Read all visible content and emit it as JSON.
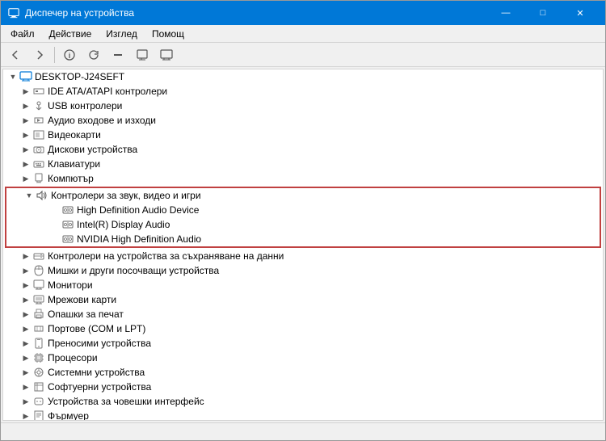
{
  "window": {
    "title": "Диспечер на устройства",
    "controls": {
      "minimize": "—",
      "maximize": "□",
      "close": "✕"
    }
  },
  "menu": {
    "items": [
      "Файл",
      "Действие",
      "Изглед",
      "Помощ"
    ]
  },
  "toolbar": {
    "buttons": [
      {
        "name": "back",
        "icon": "◀"
      },
      {
        "name": "forward",
        "icon": "▶"
      },
      {
        "name": "separator"
      },
      {
        "name": "properties",
        "icon": "ℹ"
      },
      {
        "name": "update",
        "icon": "↻"
      },
      {
        "name": "uninstall",
        "icon": "✖"
      },
      {
        "name": "scan",
        "icon": "🔍"
      },
      {
        "name": "monitor",
        "icon": "🖥"
      }
    ]
  },
  "tree": {
    "root": "DESKTOP-J24SEFT",
    "items": [
      {
        "id": "root",
        "label": "DESKTOP-J24SEFT",
        "level": 0,
        "expanded": true,
        "icon": "computer"
      },
      {
        "id": "ide",
        "label": "IDE ATA/ATAPI контролери",
        "level": 1,
        "expanded": false,
        "icon": "ide"
      },
      {
        "id": "usb",
        "label": "USB контролери",
        "level": 1,
        "expanded": false,
        "icon": "usb"
      },
      {
        "id": "audio_in",
        "label": "Аудио входове и изходи",
        "level": 1,
        "expanded": false,
        "icon": "audio"
      },
      {
        "id": "video",
        "label": "Видеокарти",
        "level": 1,
        "expanded": false,
        "icon": "video"
      },
      {
        "id": "disk",
        "label": "Дискови устройства",
        "level": 1,
        "expanded": false,
        "icon": "disk"
      },
      {
        "id": "keyboard",
        "label": "Клавиатури",
        "level": 1,
        "expanded": false,
        "icon": "keyboard"
      },
      {
        "id": "computer",
        "label": "Компютър",
        "level": 1,
        "expanded": false,
        "icon": "pc"
      },
      {
        "id": "sound_ctrl",
        "label": "Контролери за звук, видео и игри",
        "level": 1,
        "expanded": true,
        "icon": "sound",
        "highlighted": true
      },
      {
        "id": "hd_audio",
        "label": "High Definition Audio Device",
        "level": 2,
        "expanded": false,
        "icon": "device",
        "highlighted": true
      },
      {
        "id": "intel_audio",
        "label": "Intel(R) Display Audio",
        "level": 2,
        "expanded": false,
        "icon": "device",
        "highlighted": true
      },
      {
        "id": "nvidia_audio",
        "label": "NVIDIA High Definition Audio",
        "level": 2,
        "expanded": false,
        "icon": "device",
        "highlighted": true
      },
      {
        "id": "storage_ctrl",
        "label": "Контролери на устройства за съхраняване на данни",
        "level": 1,
        "expanded": false,
        "icon": "hdd"
      },
      {
        "id": "mouse",
        "label": "Мишки и други посочващи устройства",
        "level": 1,
        "expanded": false,
        "icon": "mouse"
      },
      {
        "id": "monitors",
        "label": "Монитори",
        "level": 1,
        "expanded": false,
        "icon": "monitor"
      },
      {
        "id": "network",
        "label": "Мрежови карти",
        "level": 1,
        "expanded": false,
        "icon": "network"
      },
      {
        "id": "print",
        "label": "Опашки за печат",
        "level": 1,
        "expanded": false,
        "icon": "print"
      },
      {
        "id": "ports",
        "label": "Портове (COM и LPT)",
        "level": 1,
        "expanded": false,
        "icon": "port"
      },
      {
        "id": "portable",
        "label": "Преносими устройства",
        "level": 1,
        "expanded": false,
        "icon": "portable"
      },
      {
        "id": "cpu",
        "label": "Процесори",
        "level": 1,
        "expanded": false,
        "icon": "cpu"
      },
      {
        "id": "sys_dev",
        "label": "Системни устройства",
        "level": 1,
        "expanded": false,
        "icon": "sys"
      },
      {
        "id": "soft_dev",
        "label": "Софтуерни устройства",
        "level": 1,
        "expanded": false,
        "icon": "soft"
      },
      {
        "id": "hid",
        "label": "Устройства за човешки интерфейс",
        "level": 1,
        "expanded": false,
        "icon": "hid"
      },
      {
        "id": "fw",
        "label": "Фърмуер",
        "level": 1,
        "expanded": false,
        "icon": "fw"
      }
    ]
  },
  "status": ""
}
